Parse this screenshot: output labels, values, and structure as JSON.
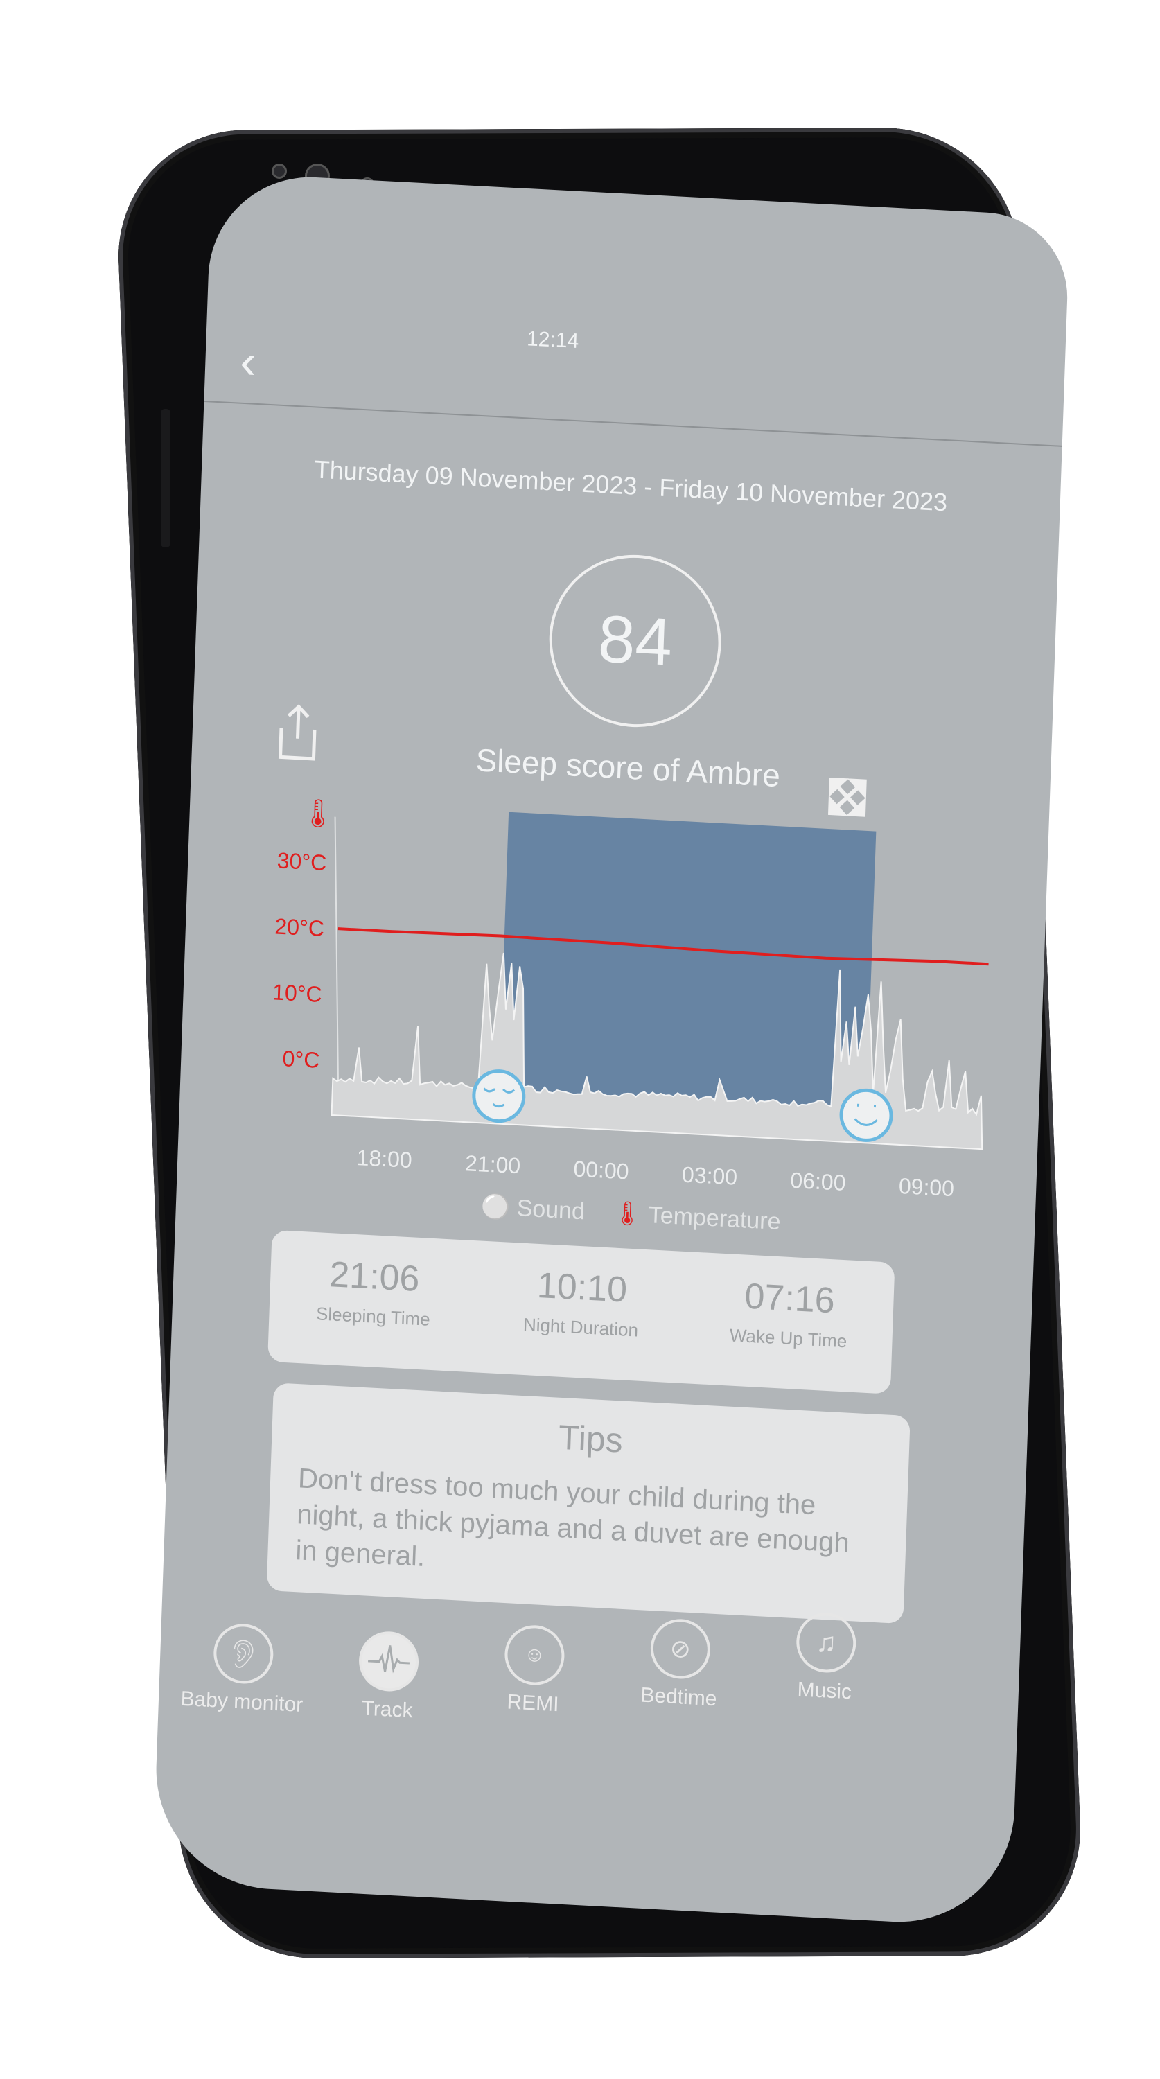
{
  "status_bar": {
    "time": "12:14"
  },
  "header": {
    "back_icon": "chevron-left-icon"
  },
  "date_range": "Thursday 09 November 2023 - Friday 10 November 2023",
  "score": {
    "value": "84",
    "label": "Sleep score of Ambre"
  },
  "actions": {
    "share_icon": "share-icon",
    "expand_icon": "expand-icon"
  },
  "chart_data": {
    "type": "area",
    "y_axis": {
      "unit_icon": "thermometer-icon",
      "tick_labels": [
        "30°C",
        "20°C",
        "10°C",
        "0°C"
      ],
      "ticks": [
        30,
        20,
        10,
        0
      ]
    },
    "x_axis": {
      "tick_labels": [
        "18:00",
        "21:00",
        "00:00",
        "03:00",
        "06:00",
        "09:00"
      ]
    },
    "sleep_period": {
      "start": "21:06",
      "end": "07:16",
      "color": "#6784a3"
    },
    "temperature_series": {
      "name": "Temperature",
      "color": "#e01e1e",
      "x": [
        "16:30",
        "18:00",
        "21:00",
        "00:00",
        "03:00",
        "06:00",
        "09:00",
        "10:30"
      ],
      "values": [
        20,
        20,
        20.2,
        20,
        19.6,
        19.4,
        19.8,
        19.8
      ]
    },
    "sound_series": {
      "name": "Sound",
      "color": "#f4f4f4"
    },
    "legend": [
      {
        "label": "Sound",
        "icon": "ear-icon"
      },
      {
        "label": "Temperature",
        "icon": "thermometer-icon"
      }
    ],
    "markers": [
      {
        "time": "21:06",
        "icon": "sleeping-face-icon"
      },
      {
        "time": "07:16",
        "icon": "smiling-face-icon"
      }
    ]
  },
  "stats": [
    {
      "value": "21:06",
      "label": "Sleeping Time"
    },
    {
      "value": "10:10",
      "label": "Night Duration"
    },
    {
      "value": "07:16",
      "label": "Wake Up Time"
    }
  ],
  "tips": {
    "title": "Tips",
    "text": "Don't dress too much your child during the night, a thick pyjama and a duvet are enough in general."
  },
  "nav": [
    {
      "label": "Baby monitor",
      "icon": "ear-icon"
    },
    {
      "label": "Track",
      "icon": "heartbeat-icon",
      "active": true
    },
    {
      "label": "REMI",
      "icon": "remi-device-icon"
    },
    {
      "label": "Bedtime",
      "icon": "bedtime-icon"
    },
    {
      "label": "Music",
      "icon": "music-note-icon"
    }
  ]
}
